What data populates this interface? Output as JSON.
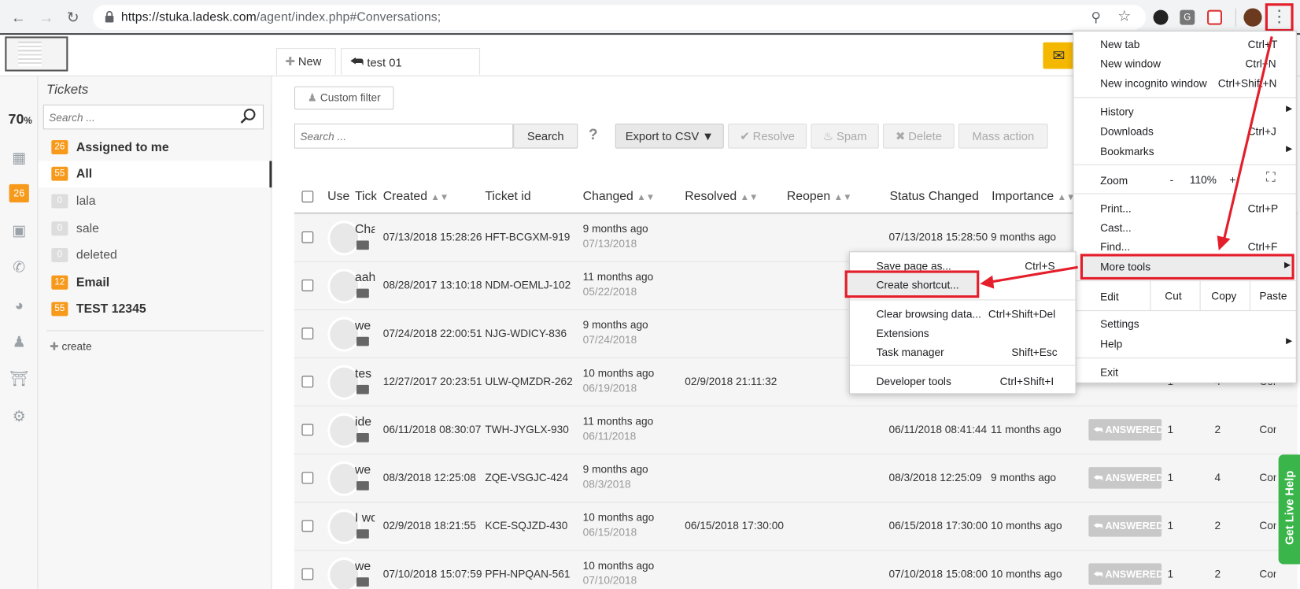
{
  "browser": {
    "url_host": "https://stuka.ladesk.com",
    "url_path": "/agent/index.php#Conversations;"
  },
  "tabs": {
    "new_label": "New",
    "ticket_label": "test 01"
  },
  "rail": {
    "zoom": "70",
    "zoom_unit": "%",
    "badge": "26"
  },
  "sidebar": {
    "title": "Tickets",
    "search_placeholder": "Search ...",
    "filters": [
      {
        "count": "26",
        "label": "Assigned to me",
        "bold": true
      },
      {
        "count": "55",
        "label": "All",
        "bold": true
      },
      {
        "count": "0",
        "label": "lala",
        "bold": false
      },
      {
        "count": "0",
        "label": "sale",
        "bold": false
      },
      {
        "count": "0",
        "label": "deleted",
        "bold": false
      },
      {
        "count": "12",
        "label": "Email",
        "bold": true
      },
      {
        "count": "55",
        "label": "TEST 12345",
        "bold": true
      }
    ],
    "create_label": "create"
  },
  "toolbar": {
    "custom_filter": "Custom filter",
    "search_placeholder": "Search ...",
    "search_button": "Search",
    "help": "?",
    "export": "Export to CSV",
    "resolve": "Resolve",
    "spam": "Spam",
    "delete": "Delete",
    "mass_action": "Mass action"
  },
  "table": {
    "headers": [
      "Use",
      "Tick",
      "Created",
      "Ticket id",
      "Changed",
      "Resolved",
      "Reopen",
      "Status Changed",
      "Importance"
    ],
    "rows": [
      {
        "subject": "Cha",
        "created": "07/13/2018 15:28:26",
        "id": "HFT-BCGXM-919",
        "changed": "9 months ago",
        "changed_date": "07/13/2018",
        "resolved": "",
        "status_changed": "07/13/2018 15:28:50",
        "importance": "9 months ago",
        "status": "",
        "c1": "",
        "c2": "",
        "c3": ""
      },
      {
        "subject": "aah",
        "created": "08/28/2017 13:10:18",
        "id": "NDM-OEMLJ-102",
        "changed": "11 months ago",
        "changed_date": "05/22/2018",
        "resolved": "",
        "status_changed": "",
        "importance": "",
        "status": "",
        "c1": "",
        "c2": "",
        "c3": ""
      },
      {
        "subject": "we",
        "created": "07/24/2018 22:00:51",
        "id": "NJG-WDICY-836",
        "changed": "9 months ago",
        "changed_date": "07/24/2018",
        "resolved": "",
        "status_changed": "",
        "importance": "",
        "status": "",
        "c1": "",
        "c2": "",
        "c3": ""
      },
      {
        "subject": "tes",
        "created": "12/27/2017 20:23:51",
        "id": "ULW-QMZDR-262",
        "changed": "10 months ago",
        "changed_date": "06/19/2018",
        "resolved": "02/9/2018 21:11:32",
        "status_changed": "",
        "importance": "",
        "status": "",
        "c1": "1",
        "c2": "4",
        "c3": "Cor"
      },
      {
        "subject": "ide",
        "created": "06/11/2018 08:30:07",
        "id": "TWH-JYGLX-930",
        "changed": "11 months ago",
        "changed_date": "06/11/2018",
        "resolved": "",
        "status_changed": "06/11/2018 08:41:44",
        "importance": "11 months ago",
        "status": "ANSWERED",
        "c1": "1",
        "c2": "2",
        "c3": "Cor"
      },
      {
        "subject": "we",
        "created": "08/3/2018 12:25:08",
        "id": "ZQE-VSGJC-424",
        "changed": "9 months ago",
        "changed_date": "08/3/2018",
        "resolved": "",
        "status_changed": "08/3/2018 12:25:09",
        "importance": "9 months ago",
        "status": "ANSWERED",
        "c1": "1",
        "c2": "4",
        "c3": "Cor"
      },
      {
        "subject": "I wo",
        "created": "02/9/2018 18:21:55",
        "id": "KCE-SQJZD-430",
        "changed": "10 months ago",
        "changed_date": "06/15/2018",
        "resolved": "06/15/2018 17:30:00",
        "status_changed": "06/15/2018 17:30:00",
        "importance": "10 months ago",
        "status": "ANSWERED",
        "c1": "1",
        "c2": "2",
        "c3": "Cor"
      },
      {
        "subject": "we",
        "created": "07/10/2018 15:07:59",
        "id": "PFH-NPQAN-561",
        "changed": "10 months ago",
        "changed_date": "07/10/2018",
        "resolved": "",
        "status_changed": "07/10/2018 15:08:00",
        "importance": "10 months ago",
        "status": "ANSWERED",
        "c1": "1",
        "c2": "2",
        "c3": "Cor"
      }
    ]
  },
  "chrome_menu": {
    "new_tab": "New tab",
    "new_tab_sc": "Ctrl+T",
    "new_window": "New window",
    "new_window_sc": "Ctrl+N",
    "incognito": "New incognito window",
    "incognito_sc": "Ctrl+Shift+N",
    "history": "History",
    "downloads": "Downloads",
    "downloads_sc": "Ctrl+J",
    "bookmarks": "Bookmarks",
    "zoom": "Zoom",
    "zoom_minus": "-",
    "zoom_value": "110%",
    "zoom_plus": "+",
    "print": "Print...",
    "print_sc": "Ctrl+P",
    "cast": "Cast...",
    "find": "Find...",
    "find_sc": "Ctrl+F",
    "more_tools": "More tools",
    "edit": "Edit",
    "cut": "Cut",
    "copy": "Copy",
    "paste": "Paste",
    "settings": "Settings",
    "help": "Help",
    "exit": "Exit"
  },
  "submenu": {
    "save_page": "Save page as...",
    "save_page_sc": "Ctrl+S",
    "create_shortcut": "Create shortcut...",
    "clear_data": "Clear browsing data...",
    "clear_data_sc": "Ctrl+Shift+Del",
    "extensions": "Extensions",
    "task_manager": "Task manager",
    "task_manager_sc": "Shift+Esc",
    "dev_tools": "Developer tools",
    "dev_tools_sc": "Ctrl+Shift+I"
  },
  "live_help": "Get Live Help",
  "colors": {
    "accent_orange": "#f79a1b",
    "annotation_red": "#e41e2b",
    "live_help_green": "#3ab54a"
  }
}
